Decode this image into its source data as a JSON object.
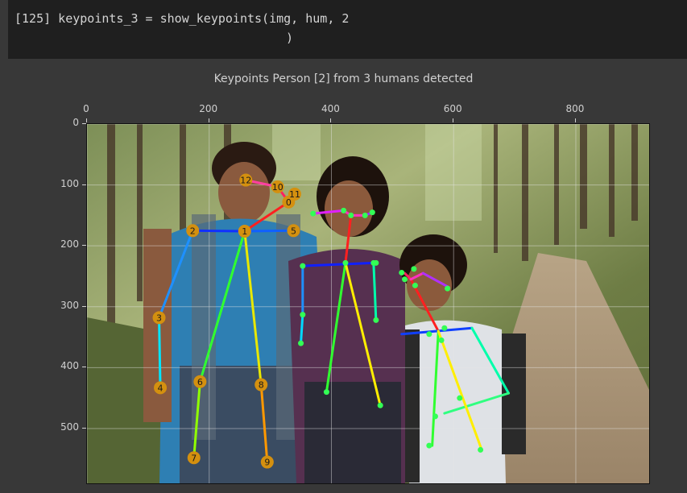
{
  "code": {
    "line1": "[125] keypoints_3 = show_keypoints(img, hum, 2",
    "line2": ")"
  },
  "chart_data": {
    "type": "image-plot",
    "title": "Keypoints Person [2] from 3 humans detected",
    "xlim": [
      0,
      920
    ],
    "ylim": [
      590,
      0
    ],
    "x_ticks": [
      "0",
      "200",
      "400",
      "600",
      "800"
    ],
    "x_tick_values": [
      0,
      200,
      400,
      600,
      800
    ],
    "y_ticks": [
      "0",
      "100",
      "200",
      "300",
      "400",
      "500"
    ],
    "y_tick_values": [
      0,
      100,
      200,
      300,
      400,
      500
    ],
    "grid": true,
    "people": [
      {
        "name": "person-2",
        "keypoints": [
          {
            "id": "0",
            "x": 330,
            "y": 128
          },
          {
            "id": "1",
            "x": 258,
            "y": 176
          },
          {
            "id": "2",
            "x": 173,
            "y": 175
          },
          {
            "id": "3",
            "x": 118,
            "y": 318
          },
          {
            "id": "4",
            "x": 120,
            "y": 433
          },
          {
            "id": "5",
            "x": 338,
            "y": 175
          },
          {
            "id": "6",
            "x": 185,
            "y": 423
          },
          {
            "id": "7",
            "x": 175,
            "y": 548
          },
          {
            "id": "8",
            "x": 285,
            "y": 428
          },
          {
            "id": "9",
            "x": 295,
            "y": 555
          },
          {
            "id": "10",
            "x": 312,
            "y": 103
          },
          {
            "id": "11",
            "x": 340,
            "y": 115
          },
          {
            "id": "12",
            "x": 260,
            "y": 92
          }
        ],
        "bones": [
          {
            "from": "1",
            "to": "0",
            "color": "#ff2020"
          },
          {
            "from": "1",
            "to": "2",
            "color": "#1030ff"
          },
          {
            "from": "1",
            "to": "5",
            "color": "#1060ff"
          },
          {
            "from": "2",
            "to": "3",
            "color": "#1e90ff"
          },
          {
            "from": "3",
            "to": "4",
            "color": "#00e5ff"
          },
          {
            "from": "1",
            "to": "6",
            "color": "#30ff30"
          },
          {
            "from": "6",
            "to": "7",
            "color": "#90ff00"
          },
          {
            "from": "1",
            "to": "8",
            "color": "#e8e800"
          },
          {
            "from": "8",
            "to": "9",
            "color": "#ff9800"
          },
          {
            "from": "0",
            "to": "10",
            "color": "#ff2060"
          },
          {
            "from": "10",
            "to": "12",
            "color": "#ff40a0"
          },
          {
            "from": "0",
            "to": "11",
            "color": "#ff6040"
          }
        ]
      }
    ],
    "other_skeletons": [
      {
        "points": [
          [
            432,
            150
          ],
          [
            353,
            233
          ],
          [
            469,
            228
          ],
          [
            353,
            313
          ],
          [
            350,
            360
          ],
          [
            473,
            228
          ],
          [
            473,
            322
          ],
          [
            392,
            440
          ],
          [
            480,
            462
          ],
          [
            423,
            228
          ],
          [
            370,
            147
          ],
          [
            467,
            145
          ],
          [
            420,
            142
          ],
          [
            455,
            150
          ]
        ],
        "bones": [
          {
            "a": [
              423,
              228
            ],
            "b": [
              432,
              150
            ],
            "color": "#ff2020"
          },
          {
            "a": [
              353,
              233
            ],
            "b": [
              469,
              228
            ],
            "color": "#1020ff"
          },
          {
            "a": [
              353,
              233
            ],
            "b": [
              353,
              313
            ],
            "color": "#1e90ff"
          },
          {
            "a": [
              353,
              313
            ],
            "b": [
              350,
              360
            ],
            "color": "#00d8ff"
          },
          {
            "a": [
              469,
              228
            ],
            "b": [
              473,
              322
            ],
            "color": "#00ffaa"
          },
          {
            "a": [
              423,
              228
            ],
            "b": [
              392,
              440
            ],
            "color": "#30ff30"
          },
          {
            "a": [
              423,
              228
            ],
            "b": [
              480,
              462
            ],
            "color": "#ffee00"
          },
          {
            "a": [
              432,
              150
            ],
            "b": [
              420,
              142
            ],
            "color": "#ff30c0"
          },
          {
            "a": [
              420,
              142
            ],
            "b": [
              370,
              147
            ],
            "color": "#e020ff"
          },
          {
            "a": [
              432,
              150
            ],
            "b": [
              455,
              150
            ],
            "color": "#ff30c0"
          },
          {
            "a": [
              455,
              150
            ],
            "b": [
              467,
              145
            ],
            "color": "#9a30ff"
          }
        ]
      },
      {
        "points": [
          [
            537,
            265
          ],
          [
            560,
            345
          ],
          [
            585,
            335
          ],
          [
            610,
            450
          ],
          [
            570,
            480
          ],
          [
            580,
            355
          ],
          [
            560,
            528
          ],
          [
            644,
            535
          ],
          [
            520,
            255
          ],
          [
            535,
            238
          ],
          [
            590,
            270
          ],
          [
            515,
            244
          ]
        ],
        "bones": [
          {
            "a": [
              530,
              255
            ],
            "b": [
              575,
              340
            ],
            "color": "#ff2020"
          },
          {
            "a": [
              515,
              345
            ],
            "b": [
              630,
              335
            ],
            "color": "#1040ff"
          },
          {
            "a": [
              630,
              335
            ],
            "b": [
              690,
              442
            ],
            "color": "#00ffaa"
          },
          {
            "a": [
              690,
              442
            ],
            "b": [
              585,
              475
            ],
            "color": "#30ff80"
          },
          {
            "a": [
              575,
              340
            ],
            "b": [
              565,
              528
            ],
            "color": "#30ff30"
          },
          {
            "a": [
              575,
              340
            ],
            "b": [
              646,
              535
            ],
            "color": "#ffee00"
          },
          {
            "a": [
              530,
              255
            ],
            "b": [
              520,
              245
            ],
            "color": "#ff2060"
          },
          {
            "a": [
              530,
              255
            ],
            "b": [
              550,
              245
            ],
            "color": "#ff30c0"
          },
          {
            "a": [
              550,
              245
            ],
            "b": [
              592,
              268
            ],
            "color": "#b030ff"
          }
        ]
      }
    ]
  }
}
